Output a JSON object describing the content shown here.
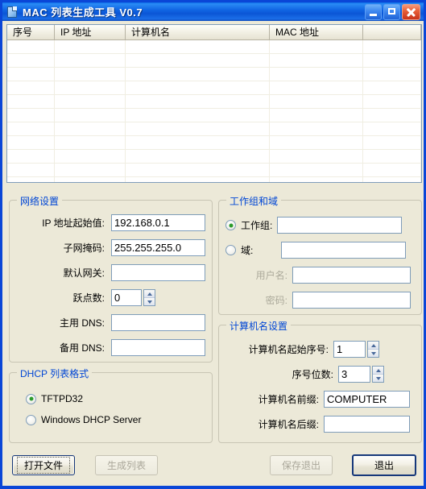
{
  "window": {
    "title": "MAC 列表生成工具 V0.7",
    "icon": "document-icon",
    "min_label": "最小化",
    "max_label": "最大化",
    "close_label": "关闭"
  },
  "list": {
    "columns": [
      "序号",
      "IP 地址",
      "计算机名",
      "MAC 地址",
      ""
    ],
    "rows": []
  },
  "network": {
    "legend": "网络设置",
    "fields": [
      {
        "label": "IP 地址起始值:",
        "value": "192.168.0.1"
      },
      {
        "label": "子网掩码:",
        "value": "255.255.255.0"
      },
      {
        "label": "默认网关:",
        "value": ""
      },
      {
        "label": "跃点数:",
        "value": "0"
      },
      {
        "label": "主用 DNS:",
        "value": ""
      },
      {
        "label": "备用 DNS:",
        "value": ""
      }
    ]
  },
  "dhcp": {
    "legend": "DHCP 列表格式",
    "options": [
      "TFTPD32",
      "Windows DHCP Server"
    ],
    "selected": "TFTPD32"
  },
  "workgroup": {
    "legend": "工作组和域",
    "workgroup_label": "工作组:",
    "workgroup_value": "",
    "domain_label": "域:",
    "domain_value": "",
    "username_label": "用户名:",
    "username_value": "",
    "password_label": "密码:",
    "password_value": "",
    "selected": "工作组"
  },
  "computer": {
    "legend": "计算机名设置",
    "start_index_label": "计算机名起始序号:",
    "start_index_value": "1",
    "digits_label": "序号位数:",
    "digits_value": "3",
    "prefix_label": "计算机名前缀:",
    "prefix_value": "COMPUTER",
    "suffix_label": "计算机名后缀:",
    "suffix_value": ""
  },
  "buttons": {
    "open_file": "打开文件",
    "generate_list": "生成列表",
    "save_exit": "保存退出",
    "exit": "退出"
  },
  "colors": {
    "titlebar_blue": "#0a46d7",
    "legend_blue": "#0046d5",
    "face": "#ece9d8",
    "radio_dot_green": "#2b9b2b",
    "field_border": "#7f9db9"
  }
}
